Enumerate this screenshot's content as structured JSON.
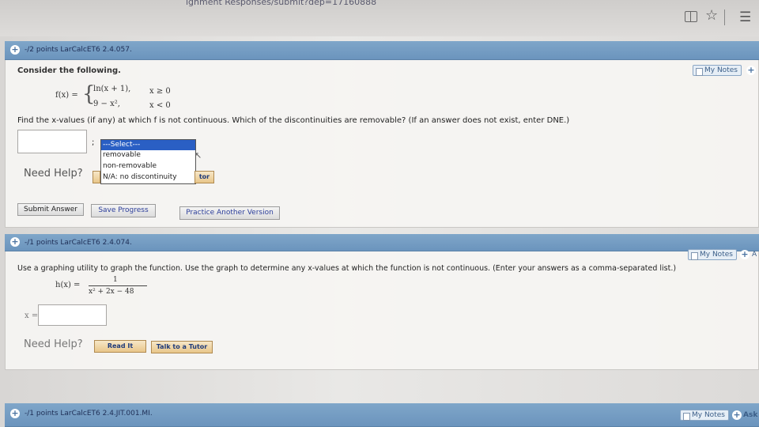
{
  "browser": {
    "url_tail": "ignment Responses/submit?dep=17160888",
    "reader_icon": "reader-icon",
    "star_icon": "star-icon",
    "menu_icon": "menu-icon"
  },
  "q1": {
    "meta": "-/2 points  LarCalcET6 2.4.057.",
    "my_notes": "My Notes",
    "prompt": "Consider the following.",
    "f_label": "f(x) =",
    "case1_expr": "ln(x + 1),",
    "case1_cond": "x ≥ 0",
    "case2_expr": "9 − x²,",
    "case2_cond": "x < 0",
    "instruction": "Find the x-values (if any) at which f is not continuous. Which of the discontinuities are removable? (If an answer does not exist, enter DNE.)",
    "separator": ";",
    "dropdown": {
      "selected": "---Select---",
      "options": [
        "---Select---",
        "removable",
        "non-removable",
        "N/A: no discontinuity"
      ]
    },
    "need_help": "Need Help?",
    "tutor_partial": "tor",
    "submit": "Submit Answer",
    "save": "Save Progress",
    "practice": "Practice Another Version"
  },
  "q2": {
    "meta": "-/1 points  LarCalcET6 2.4.074.",
    "my_notes": "My Notes",
    "ask_partial": "A",
    "prompt": "Use a graphing utility to graph the function. Use the graph to determine any x-values at which the function is not continuous. (Enter your answers as a comma-separated list.)",
    "h_label": "h(x) =",
    "numerator": "1",
    "denominator": "x² + 2x − 48",
    "x_label": "x =",
    "need_help": "Need Help?",
    "read_it": "Read It",
    "talk_tutor": "Talk to a Tutor"
  },
  "q3": {
    "meta": "-/1 points  LarCalcET6 2.4.JIT.001.MI.",
    "my_notes": "My Notes",
    "ask": "Ask"
  }
}
